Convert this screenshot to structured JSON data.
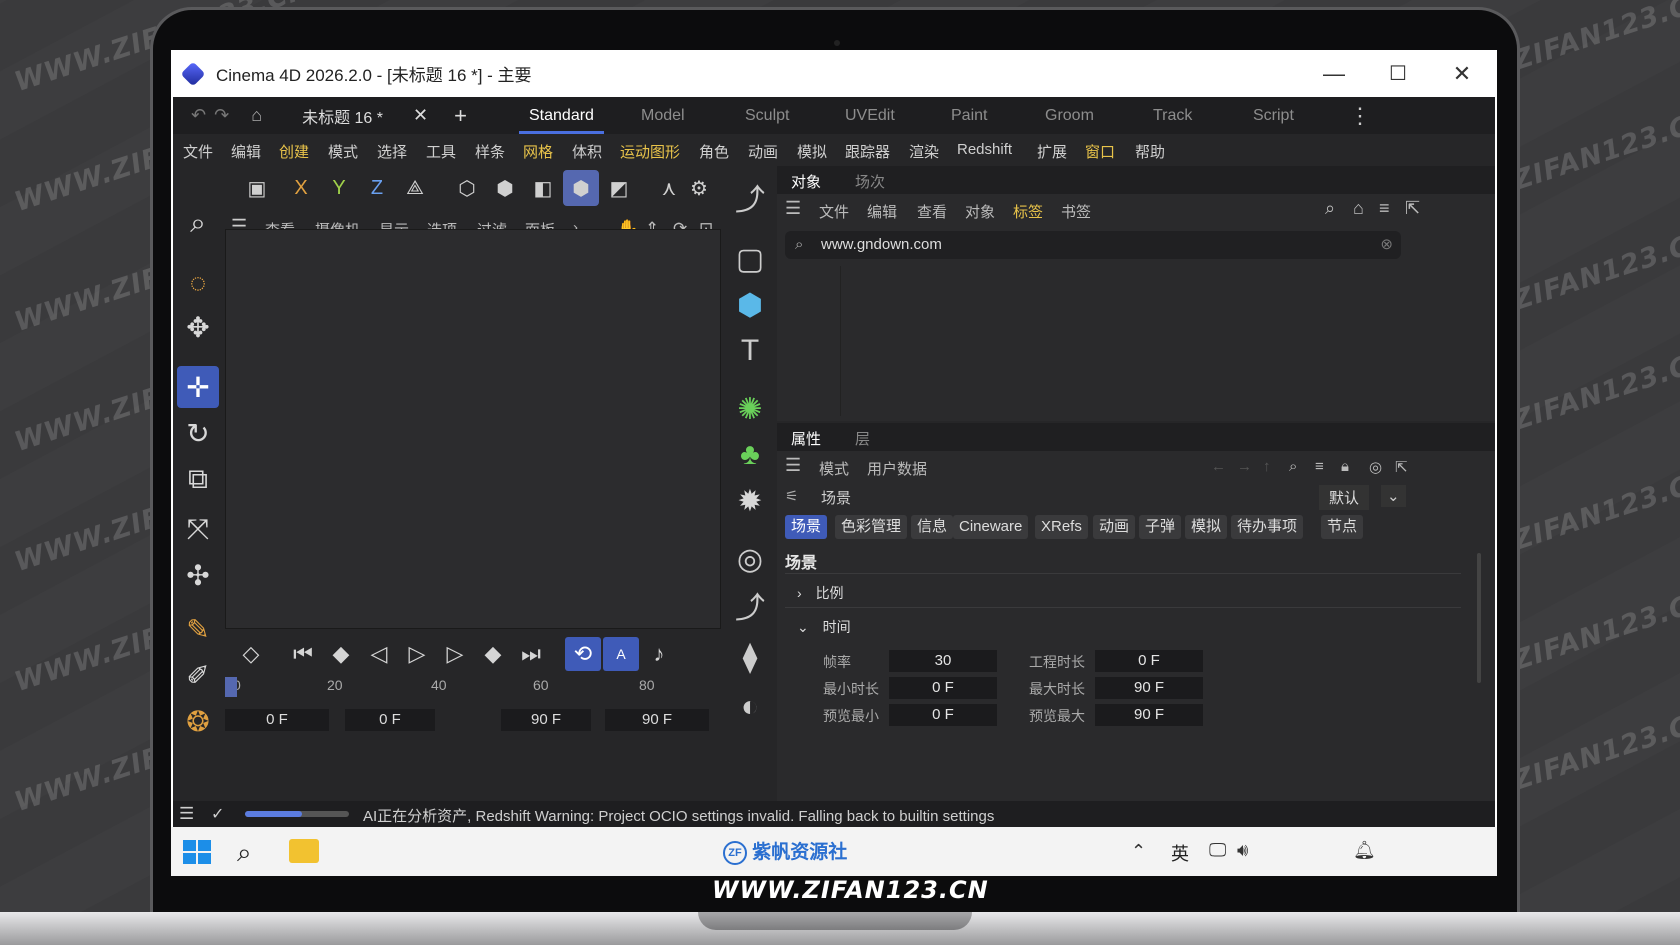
{
  "watermark": "WWW.ZIFAN123.CN",
  "window": {
    "title": "Cinema 4D 2026.2.0 - [未标题 16 *] - 主要",
    "minimize": "—",
    "maximize": "☐",
    "close": "✕"
  },
  "topbar": {
    "doc_tab": "未标题 16 *",
    "layouts": [
      "Standard",
      "Model",
      "Sculpt",
      "UVEdit",
      "Paint",
      "Groom",
      "Track",
      "Script"
    ],
    "active_layout": "Standard"
  },
  "menubar": [
    "文件",
    "编辑",
    "创建",
    "模式",
    "选择",
    "工具",
    "样条",
    "网格",
    "体积",
    "运动图形",
    "角色",
    "动画",
    "模拟",
    "跟踪器",
    "渲染",
    "Redshift",
    "扩展",
    "窗口",
    "帮助"
  ],
  "viewport_toolbar": {
    "axes": [
      "X",
      "Y",
      "Z"
    ]
  },
  "viewport_menu": [
    "查看",
    "摄像机",
    "显示",
    "选项",
    "过滤",
    "面板"
  ],
  "timeline": {
    "ruler": [
      "0",
      "20",
      "40",
      "60",
      "80"
    ],
    "fields": [
      "0 F",
      "0 F",
      "90 F",
      "90 F"
    ]
  },
  "objects_panel": {
    "tabs": [
      "对象",
      "场次"
    ],
    "menu": [
      "文件",
      "编辑",
      "查看",
      "对象",
      "标签",
      "书签"
    ],
    "search_value": "www.gndown.com"
  },
  "attributes_panel": {
    "tabs": [
      "属性",
      "层"
    ],
    "menu": [
      "模式",
      "用户数据"
    ],
    "object_name": "场景",
    "preset": "默认",
    "chips": [
      "场景",
      "色彩管理",
      "信息",
      "Cineware",
      "XRefs",
      "动画",
      "子弹",
      "模拟",
      "待办事项",
      "节点"
    ],
    "section_title": "场景",
    "groups": [
      "比例",
      "时间"
    ],
    "params": [
      {
        "label": "帧率",
        "value": "30"
      },
      {
        "label": "最小时长",
        "value": "0 F"
      },
      {
        "label": "预览最小",
        "value": "0 F"
      },
      {
        "label": "工程时长",
        "value": "0 F"
      },
      {
        "label": "最大时长",
        "value": "90 F"
      },
      {
        "label": "预览最大",
        "value": "90 F"
      }
    ]
  },
  "status": {
    "message": "AI正在分析资产, Redshift Warning: Project OCIO settings invalid. Falling back to builtin settings",
    "progress": 0.55
  },
  "taskbar": {
    "center_logo": "紫帆资源社",
    "ime": "英"
  },
  "caption": "WWW.ZIFAN123.CN",
  "colors": {
    "accent": "#3f5bb8",
    "highlight_menu": "#e8c34a",
    "panel_bg": "#2a2a2c"
  }
}
